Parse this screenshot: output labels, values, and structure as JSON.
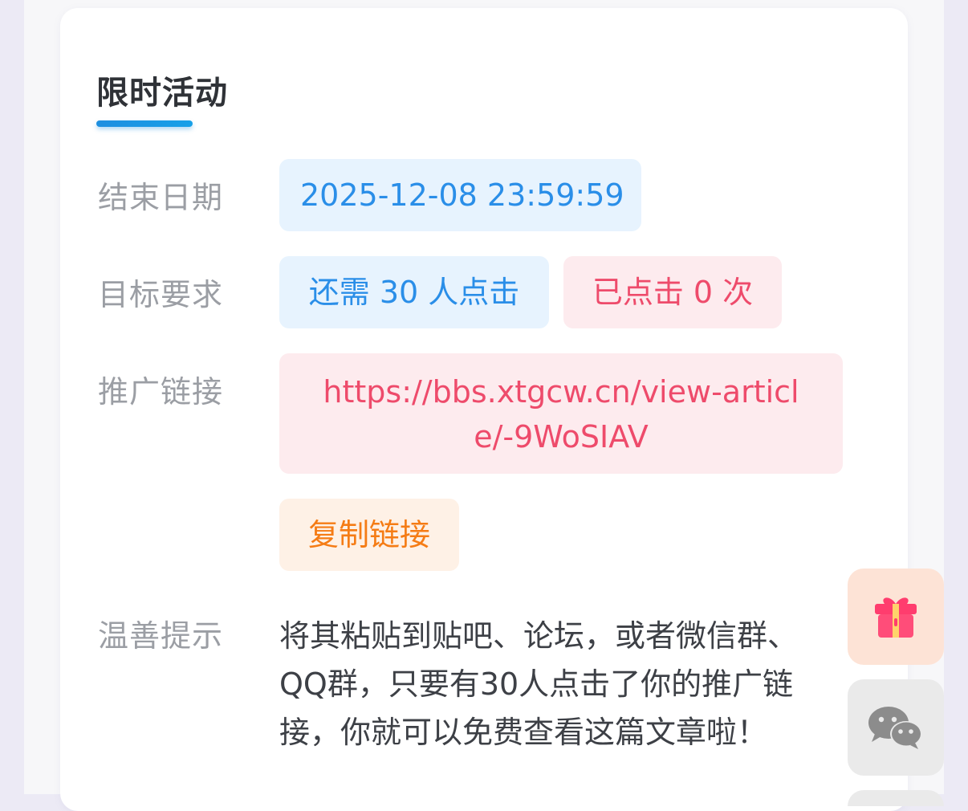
{
  "activity": {
    "title": "限时活动"
  },
  "rows": {
    "end_date": {
      "label": "结束日期",
      "value": "2025-12-08 23:59:59"
    },
    "target": {
      "label": "目标要求",
      "remaining": "还需 30 人点击",
      "clicked": "已点击 0 次"
    },
    "promo_link": {
      "label": "推广链接",
      "url": "https://bbs.xtgcw.cn/view-article/-9WoSIAV",
      "copy_label": "复制链接"
    },
    "tip": {
      "label": "温善提示",
      "text": "将其粘贴到贴吧、论坛，或者微信群、QQ群，只要有30人点击了你的推广链接，你就可以免费查看这篇文章啦！"
    }
  },
  "floating_buttons": [
    {
      "icon": "gift-icon"
    },
    {
      "icon": "wechat-icon"
    }
  ],
  "colors": {
    "accent_blue": "#2a8ee8",
    "accent_red": "#ee4b6b",
    "accent_orange": "#f57c15",
    "gift_pink": "#ff3d6e"
  }
}
